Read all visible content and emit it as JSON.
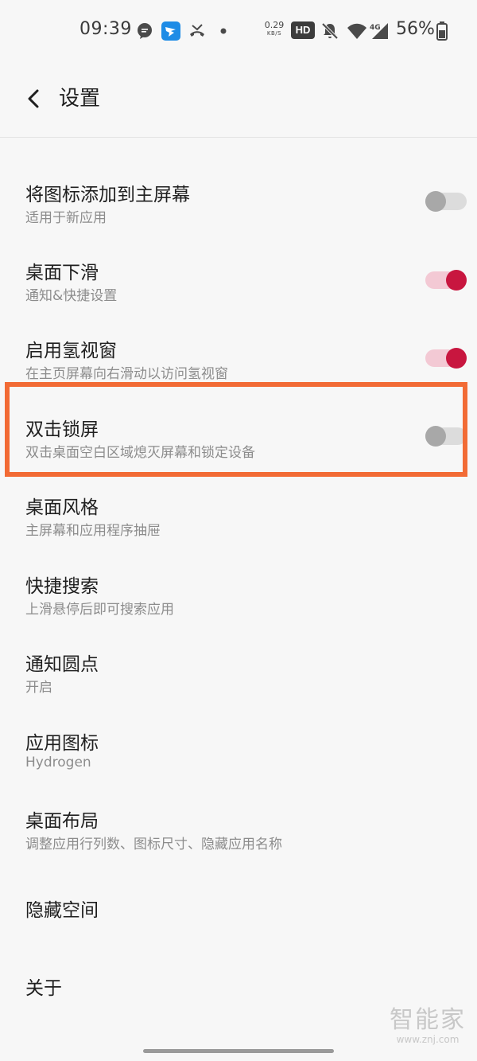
{
  "status_bar": {
    "time": "09:39",
    "net_speed_value": "0.29",
    "net_speed_unit": "KB/S",
    "hd_label": "HD",
    "network_type": "4G",
    "battery_percent": "56%",
    "icons": [
      "message-bubble-icon",
      "dingtalk-icon",
      "missed-call-icon",
      "dot-icon",
      "mute-bell-icon",
      "wifi-icon",
      "cellular-signal-icon",
      "battery-icon"
    ]
  },
  "header": {
    "back_icon": "chevron-left-icon",
    "title": "设置"
  },
  "settings": {
    "items": [
      {
        "title": "将图标添加到主屏幕",
        "subtitle": "适用于新应用",
        "toggle": "off"
      },
      {
        "title": "桌面下滑",
        "subtitle": "通知&快捷设置",
        "toggle": "on"
      },
      {
        "title": "启用氢视窗",
        "subtitle": "在主页屏幕向右滑动以访问氢视窗",
        "toggle": "on"
      },
      {
        "title": "双击锁屏",
        "subtitle": "双击桌面空白区域熄灭屏幕和锁定设备",
        "toggle": "off",
        "highlighted": true
      },
      {
        "title": "桌面风格",
        "subtitle": "主屏幕和应用程序抽屉"
      },
      {
        "title": "快捷搜索",
        "subtitle": "上滑悬停后即可搜索应用"
      },
      {
        "title": "通知圆点",
        "subtitle": "开启"
      },
      {
        "title": "应用图标",
        "subtitle": "Hydrogen"
      },
      {
        "title": "桌面布局",
        "subtitle": "调整应用行列数、图标尺寸、隐藏应用名称"
      },
      {
        "title": "隐藏空间"
      },
      {
        "title": "关于"
      }
    ]
  },
  "colors": {
    "highlight_border": "#f26b35",
    "toggle_on_knob": "#c8163f",
    "toggle_on_track": "#f3c9d4",
    "toggle_off_knob": "#a8a8a8",
    "toggle_off_track": "#dcdcdc"
  },
  "watermark": {
    "text": "智能家",
    "url": "www.znj.com"
  }
}
